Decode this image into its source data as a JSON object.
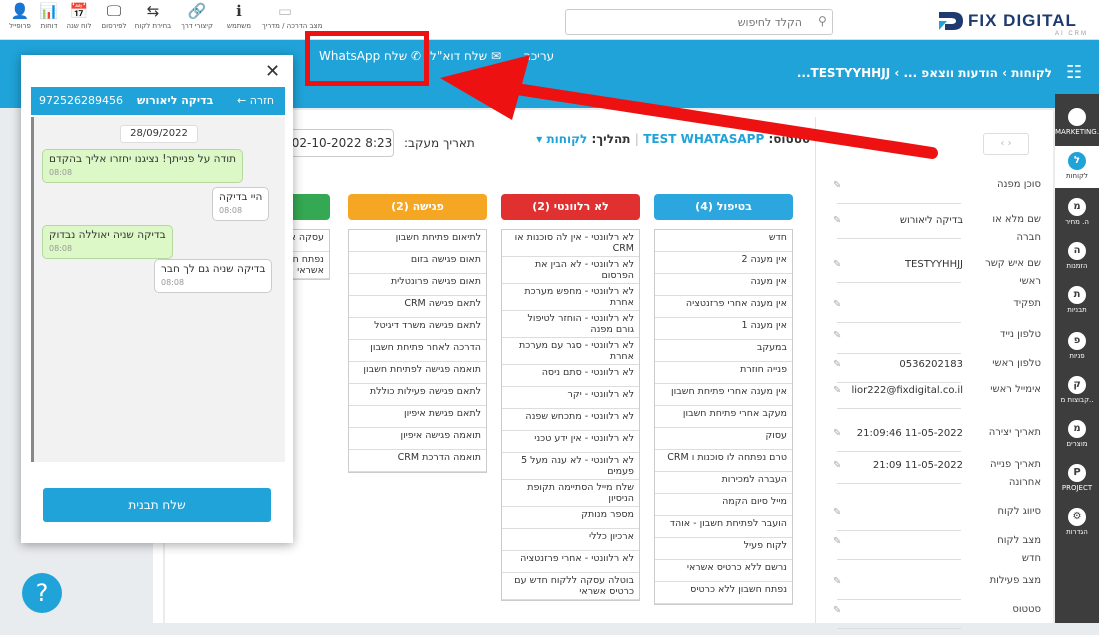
{
  "toolbar": {
    "items": [
      {
        "glyph": "👤",
        "label": "פרופייל"
      },
      {
        "glyph": "📊",
        "label": "דוחות"
      },
      {
        "glyph": "📅",
        "label": "לוח שנה"
      },
      {
        "glyph": "🖵",
        "label": "לפירסום"
      },
      {
        "glyph": "⇆",
        "label": "בחירת לקוח"
      },
      {
        "glyph": "🔗",
        "label": "קיצורי דרך"
      },
      {
        "glyph": "ℹ",
        "label": "משתמש"
      },
      {
        "glyph": "▭",
        "label": "מצב הדרכה / מדריך"
      }
    ],
    "search_placeholder": "הקלד לחיפוש",
    "logo": "FIX DIGITAL",
    "logo_sub": "AI CRM"
  },
  "bluebar": {
    "breadcrumb": "לקוחות › הודעות ווצאפ ... › TESTYYHHJJ...",
    "edit": "עריכה",
    "send_email": "שלח דוא\"ל",
    "send_whatsapp": "שלח WhatsApp"
  },
  "sidebar": [
    {
      "abbr": "",
      "label": "MARKETING.."
    },
    {
      "abbr": "ל",
      "label": "לקוחות",
      "active": true
    },
    {
      "abbr": "מ",
      "label": "ה. מחיר"
    },
    {
      "abbr": "ה",
      "label": "הזמנות"
    },
    {
      "abbr": "ת",
      "label": "תבניות"
    },
    {
      "abbr": "פ",
      "label": "פניות"
    },
    {
      "abbr": "ק",
      "label": "קבוצות מ.."
    },
    {
      "abbr": "מ",
      "label": "מוצרים"
    },
    {
      "abbr": "P",
      "label": "PROJECT"
    },
    {
      "abbr": "⚙",
      "label": "הגדרות"
    }
  ],
  "record": {
    "status_label": "סטטוס:",
    "status_value": "TEST WHATASAPP",
    "process_label": "תהליך:",
    "process_value": "לקוחות",
    "followup_label": "תאריך מעקב:",
    "followup_value": "02-10-2022 8:23"
  },
  "fields": [
    {
      "label": "סוכן מפנה",
      "value": ""
    },
    {
      "label": "שם מלא או חברה",
      "value": "בדיקה ליאורוש"
    },
    {
      "label": "שם איש קשר ראשי",
      "value": "TESTYYHHJJ"
    },
    {
      "label": "תפקיד",
      "value": ""
    },
    {
      "label": "טלפון נייד",
      "value": ""
    },
    {
      "label": "טלפון ראשי",
      "value": "0536202183"
    },
    {
      "label": "אימייל ראשי",
      "value": "lior222@fixdigital.co.il"
    },
    {
      "label": "תאריך יצירה",
      "value": "11-05-2022 21:09:46"
    },
    {
      "label": "תאריך פנייה אחרונה",
      "value": "11-05-2022 21:09"
    },
    {
      "label": "סיווג לקוח",
      "value": ""
    },
    {
      "label": "מצב לקוח חדש",
      "value": ""
    },
    {
      "label": "מצב פעילות",
      "value": ""
    },
    {
      "label": "סטטוס",
      "value": ""
    }
  ],
  "columns": [
    {
      "title": "בטיפול (4)",
      "color": "#2ba6df",
      "items": [
        "חדש",
        "אין מענה 2",
        "אין מענה",
        "אין מענה אחרי פרזנטציה",
        "אין מענה 1",
        "במעקב",
        "פנייה חוזרת",
        "אין מענה אחרי פתיחת חשבון",
        "מעקב אחרי פתיחת חשבון",
        "עסוק",
        "טרם נפתחה לו סוכנות ו CRM",
        "העברה למכירות",
        "מייל סיום הקמה",
        "הועבר לפתיחת חשבון - אוהד",
        "לקוח פעיל",
        "נרשם ללא כרטיס אשראי",
        "נפתח חשבון ללא כרטיס"
      ]
    },
    {
      "title": "לא רלוונטי (2)",
      "color": "#e0302f",
      "items": [
        "לא רלוונטי - אין לה סוכנות או CRM",
        "לא רלוונטי - לא הבין את הפרסום",
        "לא רלוונטי - מחפש מערכת אחרת",
        "לא רלוונטי - הוחזר לטיפול גורם מפנה",
        "לא רלוונטי - סגר עם מערכת אחרת",
        "לא רלוונטי - סתם ניסה",
        "לא רלוונטי - יקר",
        "לא רלוונטי - מתכחש שפנה",
        "לא רלוונטי - אין ידע טכני",
        "לא רלוונטי - לא ענה מעל 5 פעמים",
        "שלח מייל הסתיימה תקופת הניסיון",
        "מספר מנותק",
        "ארכיון כללי",
        "לא רלוונטי - אחרי פרזנטציה",
        "בוטלה עסקה ללקוח חדש עם כרטיס אשראי"
      ]
    },
    {
      "title": "פגישה (2)",
      "color": "#f5a623",
      "items": [
        "לתיאום פתיחת חשבון",
        "תאום פגישה בזום",
        "תאום פגישה פרונטלית",
        "לתאם פגישה CRM",
        "לתאם פגישה משרד דיגיטל",
        "הדרכה לאחר פתיחת חשבון",
        "תואמה פגישה לפתיחת חשבון",
        "לתאם פגישה פעילות כוללת",
        "לתאם פגישת איפיון",
        "תואמה פגישה איפיון",
        "תואמה הדרכת CRM"
      ]
    },
    {
      "title": "",
      "color": "#34a853",
      "items": [
        "עסקה איפיון",
        "נפתח חשבון אשראי"
      ]
    }
  ],
  "chat": {
    "back": "חזרה",
    "name": "בדיקה ליאורוש",
    "phone": "972526289456",
    "date": "28/09/2022",
    "messages": [
      {
        "text": "תודה על פנייתך! נציגנו יחזרו אליך בהקדם",
        "time": "08:08",
        "side": "green"
      },
      {
        "text": "היי בדיקה",
        "time": "08:08",
        "side": "white"
      },
      {
        "text": "בדיקה שניה יאוללה נבדוק",
        "time": "08:08",
        "side": "green"
      },
      {
        "text": "בדיקה שניה גם לך חבר",
        "time": "08:08",
        "side": "white"
      }
    ],
    "send_template": "שלח תבנית"
  },
  "colors": {
    "primary": "#1fa3d8",
    "annotation": "#ee1111"
  }
}
